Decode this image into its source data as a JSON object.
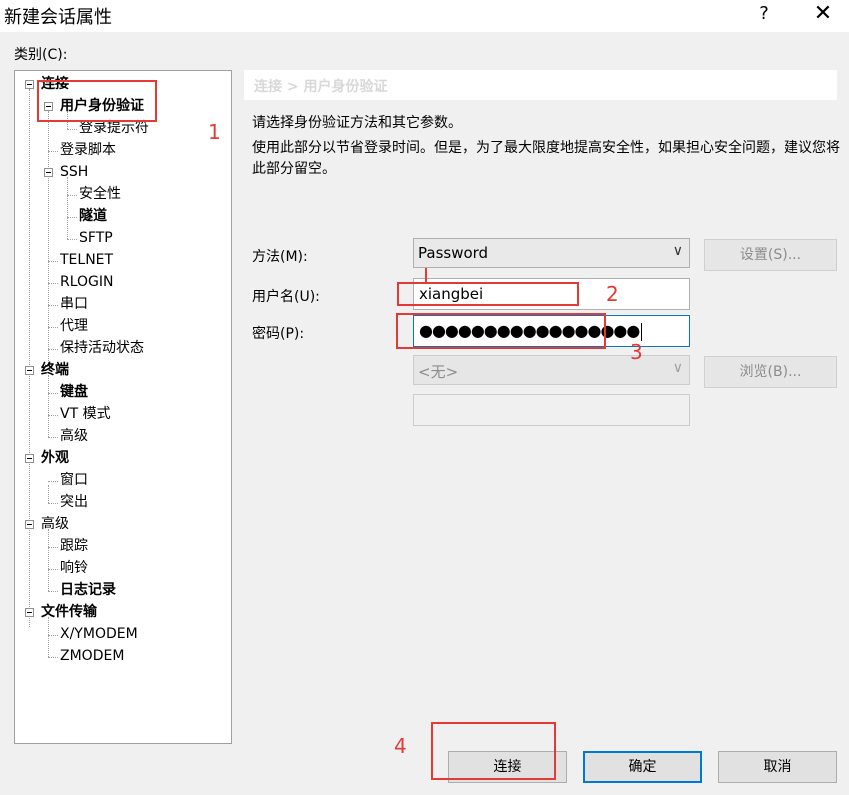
{
  "window": {
    "title": "新建会话属性",
    "help": "?",
    "close": "✕"
  },
  "category_label": "类别(C):",
  "tree": [
    {
      "label": "连接",
      "bold": true
    },
    {
      "label": "用户身份验证",
      "bold": true
    },
    {
      "label": "登录提示符",
      "bold": false
    },
    {
      "label": "登录脚本",
      "bold": false
    },
    {
      "label": "SSH",
      "bold": false
    },
    {
      "label": "安全性",
      "bold": false
    },
    {
      "label": "隧道",
      "bold": true
    },
    {
      "label": "SFTP",
      "bold": false
    },
    {
      "label": "TELNET",
      "bold": false
    },
    {
      "label": "RLOGIN",
      "bold": false
    },
    {
      "label": "串口",
      "bold": false
    },
    {
      "label": "代理",
      "bold": false
    },
    {
      "label": "保持活动状态",
      "bold": false
    },
    {
      "label": "终端",
      "bold": true
    },
    {
      "label": "键盘",
      "bold": true
    },
    {
      "label": "VT 模式",
      "bold": false
    },
    {
      "label": "高级",
      "bold": false
    },
    {
      "label": "外观",
      "bold": true
    },
    {
      "label": "窗口",
      "bold": false
    },
    {
      "label": "突出",
      "bold": false
    },
    {
      "label": "高级",
      "bold": false
    },
    {
      "label": "跟踪",
      "bold": false
    },
    {
      "label": "响铃",
      "bold": false
    },
    {
      "label": "日志记录",
      "bold": true
    },
    {
      "label": "文件传输",
      "bold": true
    },
    {
      "label": "X/YMODEM",
      "bold": false
    },
    {
      "label": "ZMODEM",
      "bold": false
    }
  ],
  "breadcrumb": "连接 > 用户身份验证",
  "desc1": "请选择身份验证方法和其它参数。",
  "desc2": "使用此部分以节省登录时间。但是，为了最大限度地提高安全性，如果担心安全问题，建议您将此部分留空。",
  "form": {
    "method_label": "方法(M):",
    "method_value": "Password",
    "settings_button": "设置(S)...",
    "username_label": "用户名(U):",
    "username_value": "xiangbei",
    "password_label": "密码(P):",
    "password_value": "●●●●●●●●●●●●●●●●●",
    "key_value": "<无>",
    "browse_button": "浏览(B)...",
    "extra_value": ""
  },
  "buttons": {
    "connect": "连接",
    "ok": "确定",
    "cancel": "取消"
  },
  "annotations": [
    "1",
    "2",
    "3",
    "4"
  ],
  "colors": {
    "highlight": "#e53935",
    "focus": "#0078d7"
  }
}
